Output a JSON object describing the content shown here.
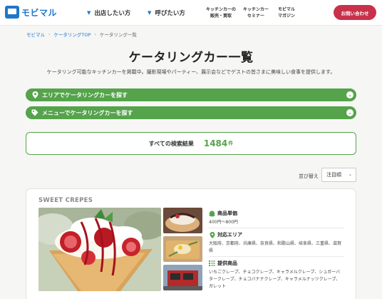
{
  "header": {
    "logo_text": "モビマル",
    "nav": [
      {
        "label": "出店したい方"
      },
      {
        "label": "呼びたい方"
      }
    ],
    "nav_small": [
      {
        "line1": "キッチンカーの",
        "line2": "販売・買取"
      },
      {
        "line1": "キッチンカー",
        "line2": "セミナー"
      },
      {
        "line1": "モビマル",
        "line2": "マガジン"
      }
    ],
    "contact_label": "お問い合わせ"
  },
  "breadcrumb": {
    "items": [
      "モビマル",
      "ケータリングTOP"
    ],
    "current": "ケータリング一覧"
  },
  "page": {
    "title": "ケータリングカー一覧",
    "description": "ケータリング可能なキッチンカーを掲載中。撮影現場やパーティー、展示会などでゲストの皆さまに美味しい食事を提供します。"
  },
  "search_bars": [
    {
      "label": "エリアでケータリングカーを探す",
      "icon": "map-pin-icon"
    },
    {
      "label": "メニューでケータリングカーを探す",
      "icon": "tag-icon"
    }
  ],
  "results": {
    "label": "すべての検索結果",
    "count": "1484",
    "unit": "件"
  },
  "sort": {
    "label": "並び替え",
    "selected": "注目順"
  },
  "card": {
    "name": "SWEET CREPES",
    "price_label": "商品単価",
    "price_value": "400円〜800円",
    "area_label": "対応エリア",
    "area_value": "大阪府、京都府、兵庫県、奈良県、和歌山県、岐阜県、三重県、滋賀県",
    "items_label": "提供商品",
    "items_value": "いちごクレープ、チョコクレープ、キャラメルクレープ、シュガーバタークレープ、チョコバナナクレープ、キャラメルナッツクレープ、ガレット"
  },
  "colors": {
    "brand_blue": "#1f77c9",
    "accent_green": "#55a34b",
    "contact_red": "#c9314b"
  }
}
